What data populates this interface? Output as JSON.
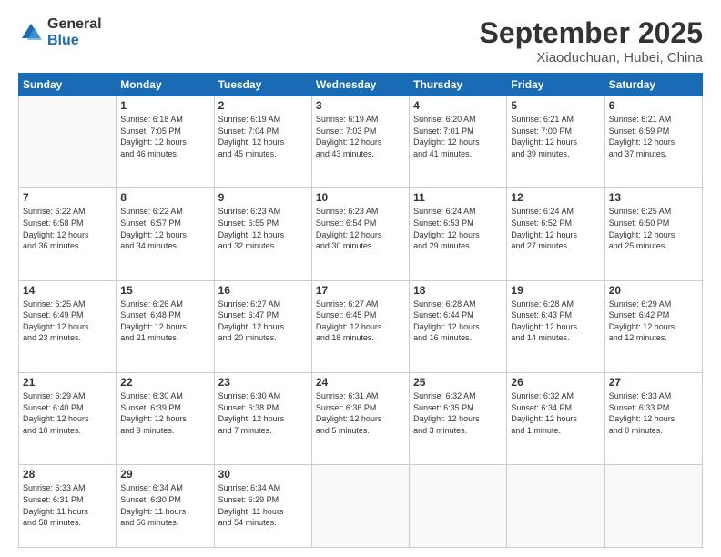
{
  "logo": {
    "general": "General",
    "blue": "Blue"
  },
  "header": {
    "month": "September 2025",
    "location": "Xiaoduchuan, Hubei, China"
  },
  "weekdays": [
    "Sunday",
    "Monday",
    "Tuesday",
    "Wednesday",
    "Thursday",
    "Friday",
    "Saturday"
  ],
  "weeks": [
    [
      {
        "day": "",
        "info": ""
      },
      {
        "day": "1",
        "info": "Sunrise: 6:18 AM\nSunset: 7:05 PM\nDaylight: 12 hours\nand 46 minutes."
      },
      {
        "day": "2",
        "info": "Sunrise: 6:19 AM\nSunset: 7:04 PM\nDaylight: 12 hours\nand 45 minutes."
      },
      {
        "day": "3",
        "info": "Sunrise: 6:19 AM\nSunset: 7:03 PM\nDaylight: 12 hours\nand 43 minutes."
      },
      {
        "day": "4",
        "info": "Sunrise: 6:20 AM\nSunset: 7:01 PM\nDaylight: 12 hours\nand 41 minutes."
      },
      {
        "day": "5",
        "info": "Sunrise: 6:21 AM\nSunset: 7:00 PM\nDaylight: 12 hours\nand 39 minutes."
      },
      {
        "day": "6",
        "info": "Sunrise: 6:21 AM\nSunset: 6:59 PM\nDaylight: 12 hours\nand 37 minutes."
      }
    ],
    [
      {
        "day": "7",
        "info": "Sunrise: 6:22 AM\nSunset: 6:58 PM\nDaylight: 12 hours\nand 36 minutes."
      },
      {
        "day": "8",
        "info": "Sunrise: 6:22 AM\nSunset: 6:57 PM\nDaylight: 12 hours\nand 34 minutes."
      },
      {
        "day": "9",
        "info": "Sunrise: 6:23 AM\nSunset: 6:55 PM\nDaylight: 12 hours\nand 32 minutes."
      },
      {
        "day": "10",
        "info": "Sunrise: 6:23 AM\nSunset: 6:54 PM\nDaylight: 12 hours\nand 30 minutes."
      },
      {
        "day": "11",
        "info": "Sunrise: 6:24 AM\nSunset: 6:53 PM\nDaylight: 12 hours\nand 29 minutes."
      },
      {
        "day": "12",
        "info": "Sunrise: 6:24 AM\nSunset: 6:52 PM\nDaylight: 12 hours\nand 27 minutes."
      },
      {
        "day": "13",
        "info": "Sunrise: 6:25 AM\nSunset: 6:50 PM\nDaylight: 12 hours\nand 25 minutes."
      }
    ],
    [
      {
        "day": "14",
        "info": "Sunrise: 6:25 AM\nSunset: 6:49 PM\nDaylight: 12 hours\nand 23 minutes."
      },
      {
        "day": "15",
        "info": "Sunrise: 6:26 AM\nSunset: 6:48 PM\nDaylight: 12 hours\nand 21 minutes."
      },
      {
        "day": "16",
        "info": "Sunrise: 6:27 AM\nSunset: 6:47 PM\nDaylight: 12 hours\nand 20 minutes."
      },
      {
        "day": "17",
        "info": "Sunrise: 6:27 AM\nSunset: 6:45 PM\nDaylight: 12 hours\nand 18 minutes."
      },
      {
        "day": "18",
        "info": "Sunrise: 6:28 AM\nSunset: 6:44 PM\nDaylight: 12 hours\nand 16 minutes."
      },
      {
        "day": "19",
        "info": "Sunrise: 6:28 AM\nSunset: 6:43 PM\nDaylight: 12 hours\nand 14 minutes."
      },
      {
        "day": "20",
        "info": "Sunrise: 6:29 AM\nSunset: 6:42 PM\nDaylight: 12 hours\nand 12 minutes."
      }
    ],
    [
      {
        "day": "21",
        "info": "Sunrise: 6:29 AM\nSunset: 6:40 PM\nDaylight: 12 hours\nand 10 minutes."
      },
      {
        "day": "22",
        "info": "Sunrise: 6:30 AM\nSunset: 6:39 PM\nDaylight: 12 hours\nand 9 minutes."
      },
      {
        "day": "23",
        "info": "Sunrise: 6:30 AM\nSunset: 6:38 PM\nDaylight: 12 hours\nand 7 minutes."
      },
      {
        "day": "24",
        "info": "Sunrise: 6:31 AM\nSunset: 6:36 PM\nDaylight: 12 hours\nand 5 minutes."
      },
      {
        "day": "25",
        "info": "Sunrise: 6:32 AM\nSunset: 6:35 PM\nDaylight: 12 hours\nand 3 minutes."
      },
      {
        "day": "26",
        "info": "Sunrise: 6:32 AM\nSunset: 6:34 PM\nDaylight: 12 hours\nand 1 minute."
      },
      {
        "day": "27",
        "info": "Sunrise: 6:33 AM\nSunset: 6:33 PM\nDaylight: 12 hours\nand 0 minutes."
      }
    ],
    [
      {
        "day": "28",
        "info": "Sunrise: 6:33 AM\nSunset: 6:31 PM\nDaylight: 11 hours\nand 58 minutes."
      },
      {
        "day": "29",
        "info": "Sunrise: 6:34 AM\nSunset: 6:30 PM\nDaylight: 11 hours\nand 56 minutes."
      },
      {
        "day": "30",
        "info": "Sunrise: 6:34 AM\nSunset: 6:29 PM\nDaylight: 11 hours\nand 54 minutes."
      },
      {
        "day": "",
        "info": ""
      },
      {
        "day": "",
        "info": ""
      },
      {
        "day": "",
        "info": ""
      },
      {
        "day": "",
        "info": ""
      }
    ]
  ]
}
